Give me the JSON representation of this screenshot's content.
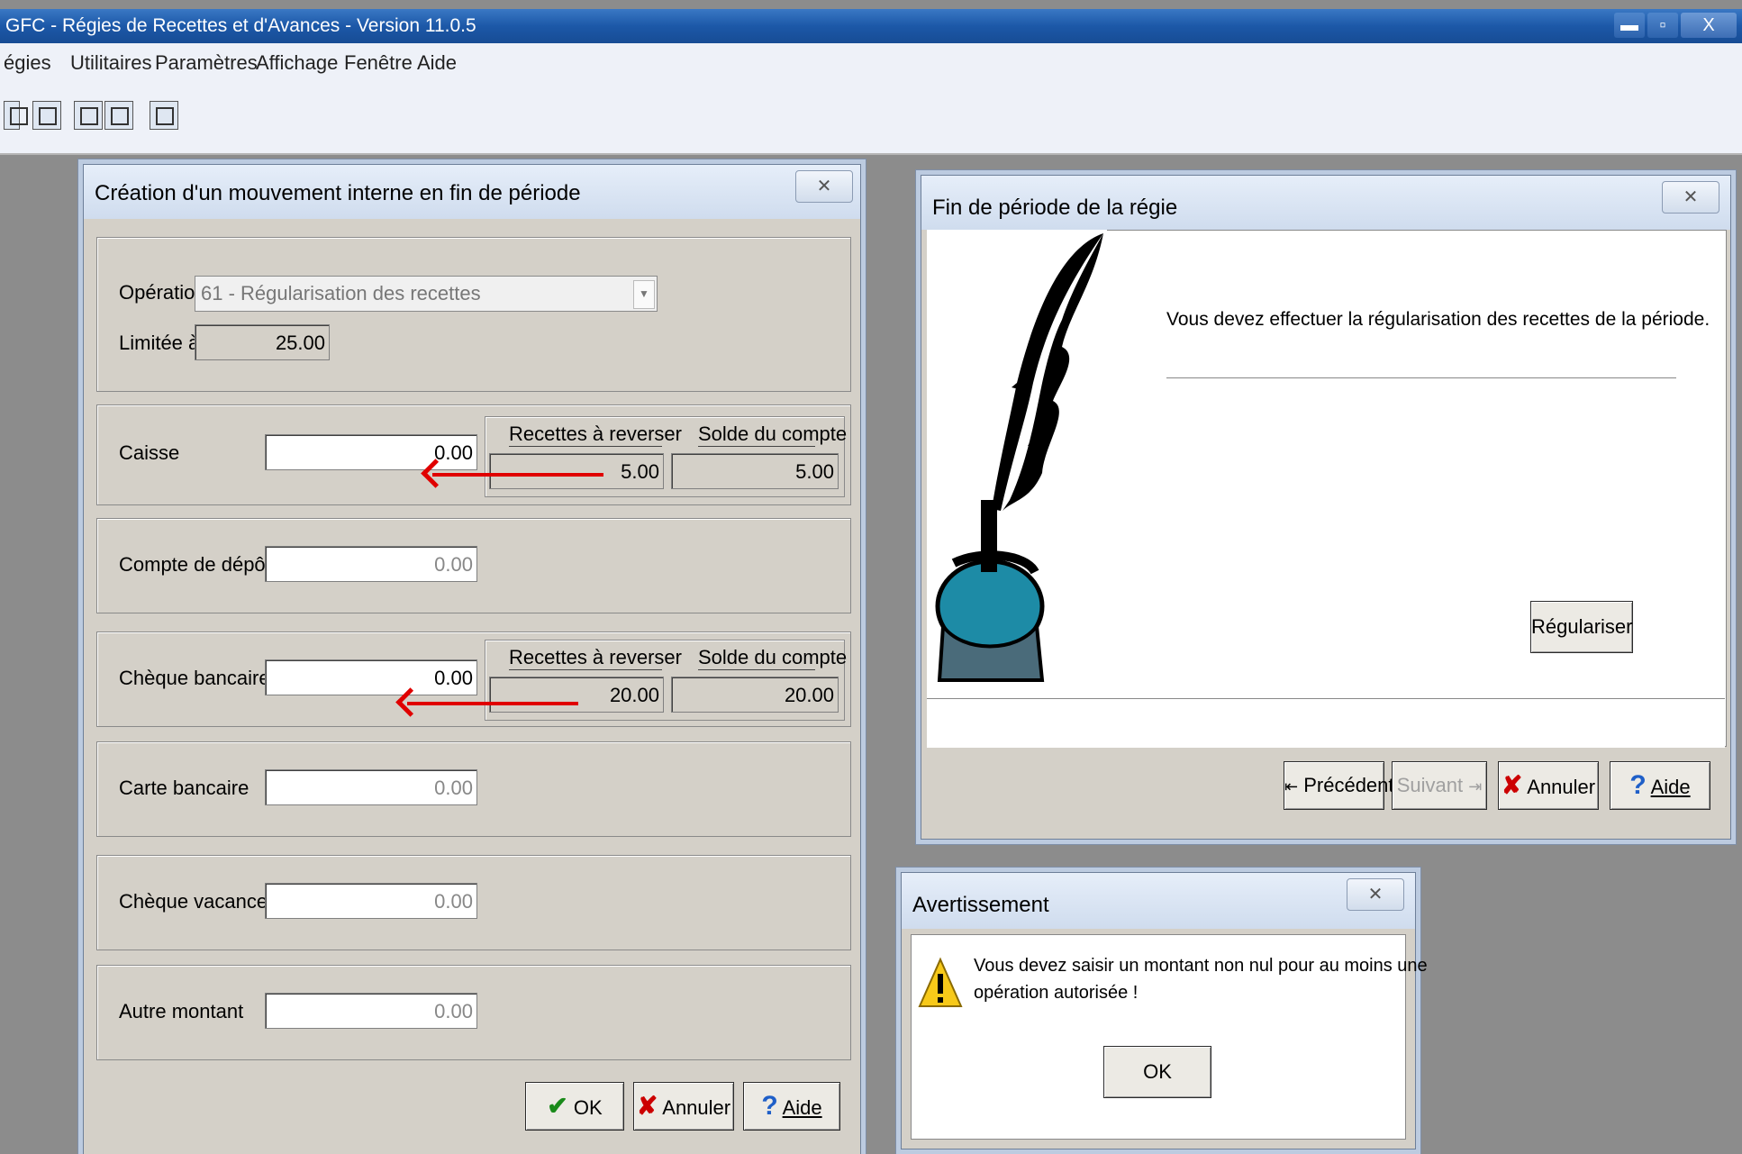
{
  "app": {
    "title": "GFC - Régies de Recettes et d'Avances - Version 11.0.5",
    "window_buttons": {
      "minimize": "▬",
      "maximize": "▫",
      "close": "X"
    }
  },
  "menu": [
    "égies",
    "Utilitaires",
    "Paramètres",
    "Affichage",
    "Fenêtre",
    "Aide"
  ],
  "toolbar_icons": [
    "save-icon",
    "home-icon",
    "edit-icon",
    "edit-alt-icon",
    "search-icon"
  ],
  "movement_dialog": {
    "title": "Création d'un mouvement interne en fin de période",
    "close": "✕",
    "operation_label": "Opération",
    "operation_value": "61 - Régularisation des recettes",
    "limited_label": "Limitée à",
    "limited_value": "25.00",
    "rows": [
      {
        "label": "Caisse",
        "value": "0.00",
        "recettes_header": "Recettes à reverser",
        "solde_header": "Solde du compte",
        "recettes_value": "5.00",
        "solde_value": "5.00"
      },
      {
        "label": "Compte de dépôt",
        "value": "0.00"
      },
      {
        "label": "Chèque bancaire",
        "value": "0.00",
        "recettes_header": "Recettes à reverser",
        "solde_header": "Solde du compte",
        "recettes_value": "20.00",
        "solde_value": "20.00"
      },
      {
        "label": "Carte bancaire",
        "value": "0.00"
      },
      {
        "label": "Chèque vacances",
        "value": "0.00"
      },
      {
        "label": "Autre montant",
        "value": "0.00"
      }
    ],
    "buttons": {
      "ok": "OK",
      "cancel": "Annuler",
      "help": "Aide"
    }
  },
  "period_dialog": {
    "title": "Fin de période de la régie",
    "close": "✕",
    "message": "Vous devez effectuer la régularisation des recettes de la période.",
    "regulariser": "Régulariser",
    "buttons": {
      "previous": "Précédent",
      "next": "Suivant",
      "cancel": "Annuler",
      "help": "Aide"
    }
  },
  "warning_dialog": {
    "title": "Avertissement",
    "close": "✕",
    "message_line1": "Vous devez saisir un montant non nul pour au moins une",
    "message_line2": "opération autorisée !",
    "ok": "OK"
  },
  "colors": {
    "titlebar": "#1c58a8",
    "annotation_arrow": "#e00000",
    "dialog_bg": "#d4d0c8"
  }
}
